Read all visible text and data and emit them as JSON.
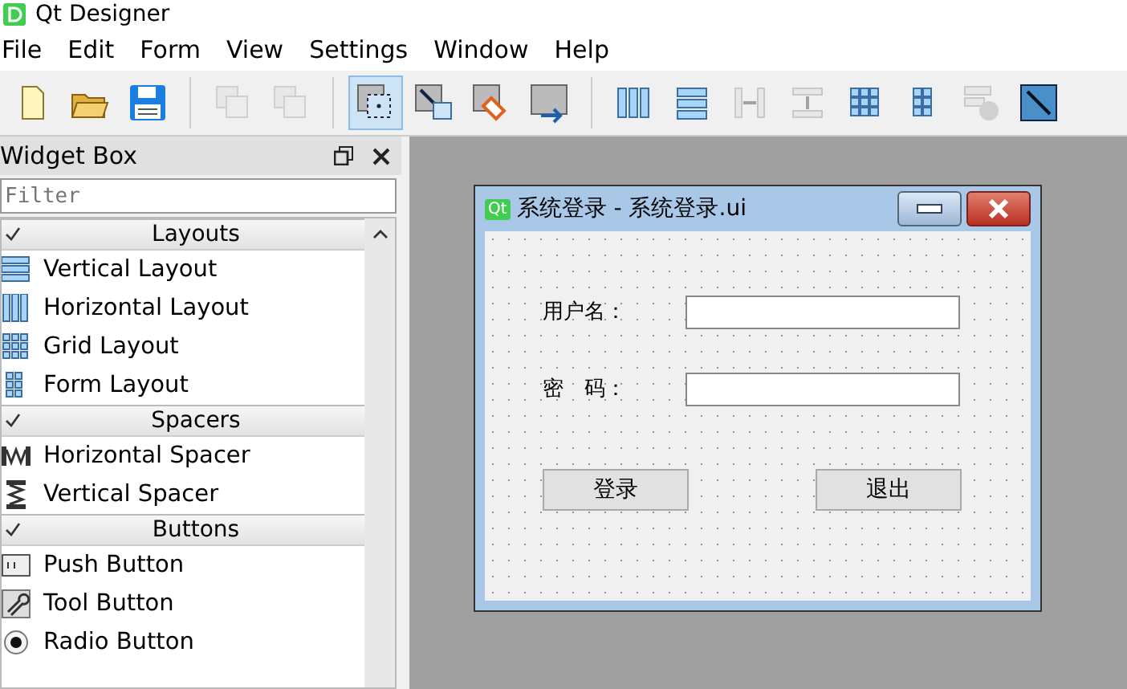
{
  "window": {
    "title": "Qt Designer"
  },
  "menu": [
    {
      "label": "File"
    },
    {
      "label": "Edit"
    },
    {
      "label": "Form"
    },
    {
      "label": "View"
    },
    {
      "label": "Settings"
    },
    {
      "label": "Window"
    },
    {
      "label": "Help"
    }
  ],
  "toolbar": [
    {
      "kind": "new",
      "selected": false,
      "disabled": false
    },
    {
      "kind": "open",
      "selected": false,
      "disabled": false
    },
    {
      "kind": "save",
      "selected": false,
      "disabled": false
    },
    {
      "kind": "sep"
    },
    {
      "kind": "front",
      "selected": false,
      "disabled": true
    },
    {
      "kind": "back",
      "selected": false,
      "disabled": true
    },
    {
      "kind": "sep"
    },
    {
      "kind": "widgets",
      "selected": true,
      "disabled": false
    },
    {
      "kind": "signals",
      "selected": false,
      "disabled": false
    },
    {
      "kind": "buddies",
      "selected": false,
      "disabled": false
    },
    {
      "kind": "taborder",
      "selected": false,
      "disabled": false
    },
    {
      "kind": "sep"
    },
    {
      "kind": "hlayout",
      "selected": false,
      "disabled": false
    },
    {
      "kind": "vlayout",
      "selected": false,
      "disabled": false
    },
    {
      "kind": "hsplit",
      "selected": false,
      "disabled": true
    },
    {
      "kind": "vsplit",
      "selected": false,
      "disabled": true
    },
    {
      "kind": "grid",
      "selected": false,
      "disabled": false
    },
    {
      "kind": "form",
      "selected": false,
      "disabled": false
    },
    {
      "kind": "break",
      "selected": false,
      "disabled": true
    },
    {
      "kind": "adjust",
      "selected": false,
      "disabled": false
    }
  ],
  "widget_box": {
    "title": "Widget Box",
    "filter": {
      "placeholder": "Filter"
    },
    "categories": [
      {
        "label": "Layouts",
        "expanded": true,
        "items": [
          {
            "label": "Vertical Layout",
            "kind": "vlayout"
          },
          {
            "label": "Horizontal Layout",
            "kind": "hlayout"
          },
          {
            "label": "Grid Layout",
            "kind": "grid"
          },
          {
            "label": "Form Layout",
            "kind": "form"
          }
        ]
      },
      {
        "label": "Spacers",
        "expanded": true,
        "items": [
          {
            "label": "Horizontal Spacer",
            "kind": "hspacer"
          },
          {
            "label": "Vertical Spacer",
            "kind": "vspacer"
          }
        ]
      },
      {
        "label": "Buttons",
        "expanded": true,
        "items": [
          {
            "label": "Push Button",
            "kind": "push"
          },
          {
            "label": "Tool Button",
            "kind": "tool"
          },
          {
            "label": "Radio Button",
            "kind": "radio"
          }
        ]
      }
    ]
  },
  "form_window": {
    "logo": "Qt",
    "title": "系统登录 - 系统登录.ui",
    "fields": [
      {
        "label": "用户名："
      },
      {
        "label": "密　码："
      }
    ],
    "buttons": [
      "登录",
      "退出"
    ]
  }
}
